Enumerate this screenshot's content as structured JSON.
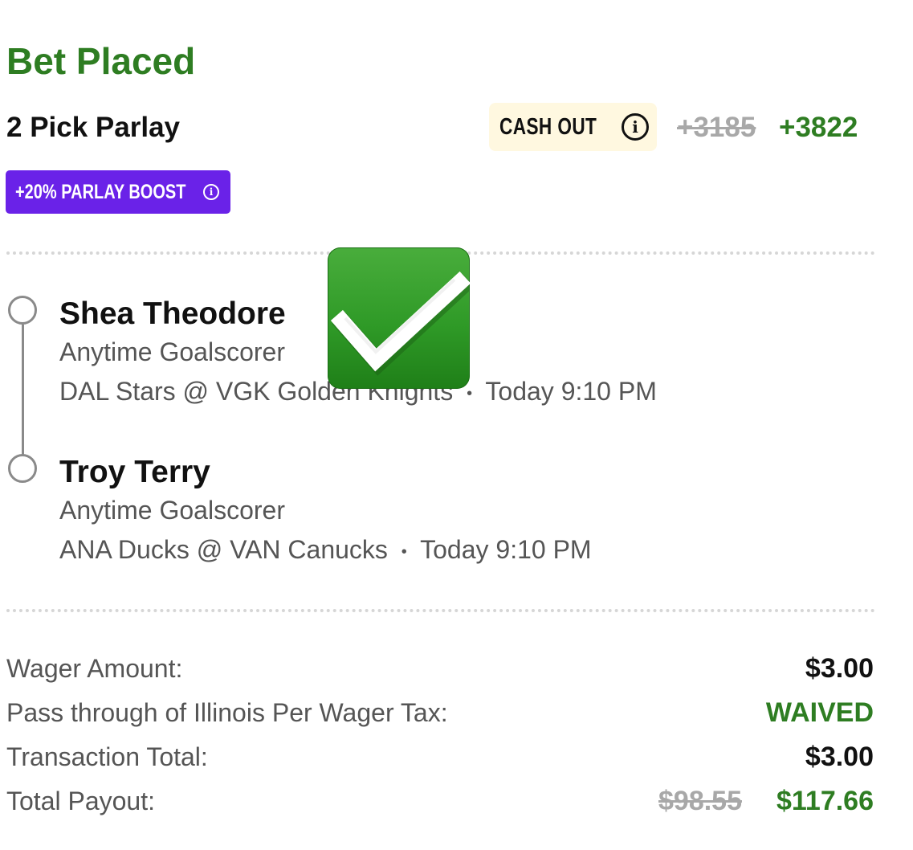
{
  "header": {
    "title": "Bet Placed",
    "bet_type": "2 Pick Parlay",
    "cash_out_label": "CASH OUT",
    "odds_original": "+3185",
    "odds_boosted": "+3822",
    "boost_label": "+20% PARLAY BOOST"
  },
  "picks": [
    {
      "player": "Shea Theodore",
      "market": "Anytime Goalscorer",
      "game": "DAL Stars @ VGK Golden Knights",
      "time": "Today 9:10 PM"
    },
    {
      "player": "Troy Terry",
      "market": "Anytime Goalscorer",
      "game": "ANA Ducks @ VAN Canucks",
      "time": "Today 9:10 PM"
    }
  ],
  "separator": "•",
  "summary": {
    "wager_label": "Wager Amount:",
    "wager_value": "$3.00",
    "tax_label": "Pass through of Illinois Per Wager Tax:",
    "tax_value": "WAIVED",
    "total_label": "Transaction Total:",
    "total_value": "$3.00",
    "payout_label": "Total Payout:",
    "payout_original": "$98.55",
    "payout_boosted": "$117.66"
  },
  "colors": {
    "accent_green": "#2e7d22",
    "boost_purple": "#6a22e8",
    "cashout_bg": "#fff8e0",
    "strike_gray": "#a8a8a8",
    "checkmark_green": "#2f9a27"
  },
  "icons": {
    "info": "info-icon",
    "check": "checkmark-emoji-icon",
    "leg_marker": "leg-circle-icon"
  }
}
